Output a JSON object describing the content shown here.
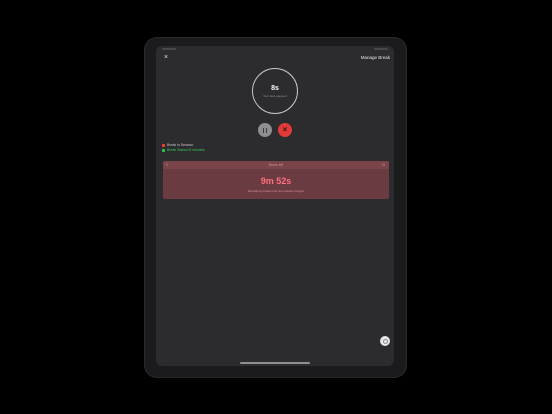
{
  "header": {
    "close_symbol": "×",
    "manage_label": "Manage Break"
  },
  "timer": {
    "value": "8s",
    "subtitle": "Sub-task elapsed"
  },
  "controls": {
    "pause_icon": "pause-icon",
    "stop_symbol": "×"
  },
  "sessions": [
    {
      "label": "Break in Session",
      "color": "#ff3b30"
    },
    {
      "label": "Break Started 8 minutes",
      "color": "#34c759"
    }
  ],
  "break_card": {
    "header_title": "Break left",
    "left_icon": "≡",
    "right_icon": "⊡",
    "time": "9m 52s",
    "caption": "Remaining break until next session begins",
    "background": "#6b3b42",
    "accent": "#ff6f7f"
  },
  "fab_icon": "settings-icon"
}
